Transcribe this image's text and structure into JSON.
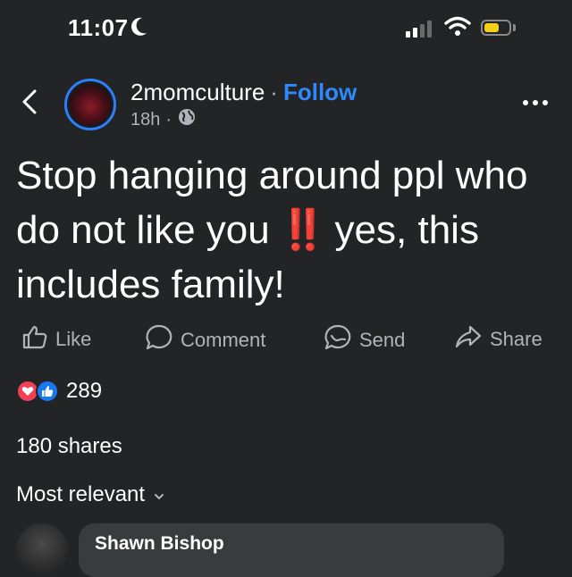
{
  "status_bar": {
    "time": "11:07",
    "moon_icon": "crescent-moon-icon",
    "signal_icon": "cellular-signal-icon",
    "wifi_icon": "wifi-icon",
    "battery_icon": "battery-icon",
    "battery_color": "#f5d01b"
  },
  "header": {
    "back_icon": "chevron-left-icon",
    "author": "2momculture",
    "separator": "·",
    "follow_label": "Follow",
    "time_ago": "18h",
    "meta_separator": "·",
    "audience_icon": "globe-icon",
    "more_icon": "more-dots-icon"
  },
  "post": {
    "text_part1": "Stop hanging around ppl who do not like you",
    "emoji": "‼️",
    "text_part2": "yes, this includes family!"
  },
  "actions": {
    "like": "Like",
    "comment": "Comment",
    "send": "Send",
    "share": "Share"
  },
  "reactions": {
    "count": "289",
    "love_color": "#f33e58",
    "like_color": "#1877f2"
  },
  "shares": "180 shares",
  "sort": {
    "label": "Most relevant"
  },
  "comment": {
    "author": "Shawn Bishop"
  },
  "colors": {
    "background": "#232425",
    "accent": "#2e89ff",
    "muted_text": "#b0b3b8"
  }
}
